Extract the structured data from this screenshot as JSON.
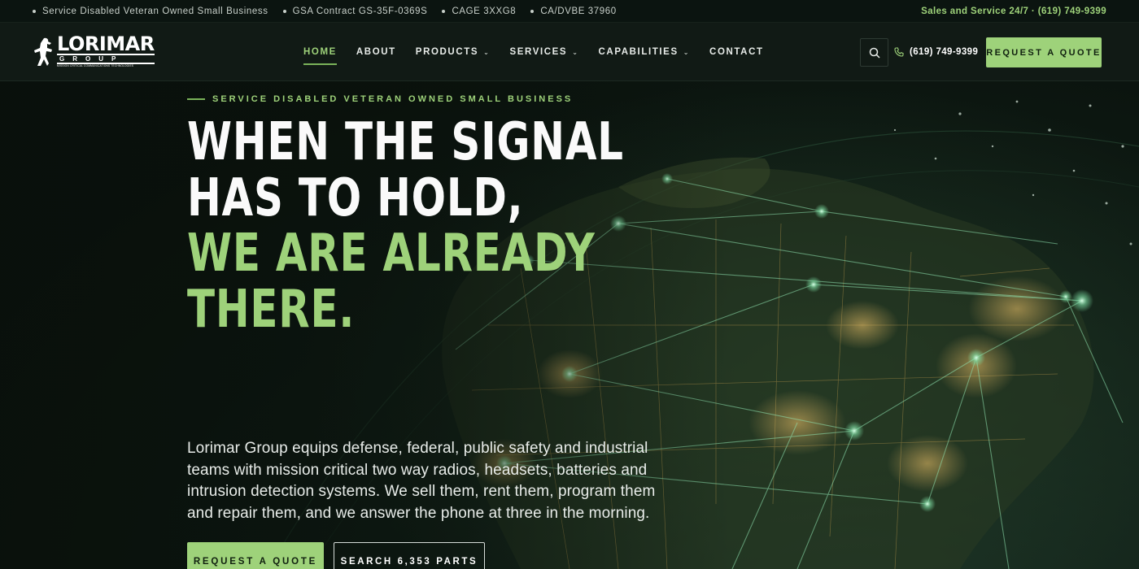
{
  "topbar": {
    "items": [
      {
        "label": "Service Disabled Veteran Owned Small Business"
      },
      {
        "label": "GSA Contract GS-35F-0369S"
      },
      {
        "label": "CAGE 3XXG8"
      },
      {
        "label": "CA/DVBE 37960"
      }
    ],
    "right_text": "Sales and Service 24/7 · (619) 749-9399"
  },
  "header": {
    "logo": {
      "main": "LORIMAR",
      "sub": "GROUP",
      "tagline": "MISSION CRITICAL COMMUNICATIONS TECHNOLOGIES",
      "icon": "figure-logo-icon"
    },
    "nav": [
      {
        "label": "HOME",
        "active": true
      },
      {
        "label": "ABOUT"
      },
      {
        "label": "PRODUCTS",
        "dropdown": true
      },
      {
        "label": "SERVICES",
        "dropdown": true
      },
      {
        "label": "CAPABILITIES",
        "dropdown": true
      },
      {
        "label": "CONTACT"
      }
    ],
    "search_icon": "search-icon",
    "phone": "(619) 749-9399",
    "phone_icon": "phone-icon",
    "quote_button": "REQUEST A QUOTE"
  },
  "hero": {
    "eyebrow": "SERVICE DISABLED VETERAN OWNED SMALL BUSINESS",
    "headline": [
      "WHEN THE SIGNAL",
      "HAS TO HOLD,",
      "WE ARE ALREADY",
      "THERE."
    ],
    "description": "Lorimar Group equips defense, federal, public safety and industrial teams with mission critical two way radios, headsets, batteries and intrusion detection systems. We sell them, rent them, program them and repair them, and we answer the phone at three in the morning.",
    "primary_button": "REQUEST A QUOTE",
    "secondary_button": "SEARCH 6,353 PARTS"
  },
  "colors": {
    "accent": "#9ed27a",
    "background": "#0b130e",
    "map_lights": "#e7b85a",
    "network_lines": "#8fe3b0"
  }
}
